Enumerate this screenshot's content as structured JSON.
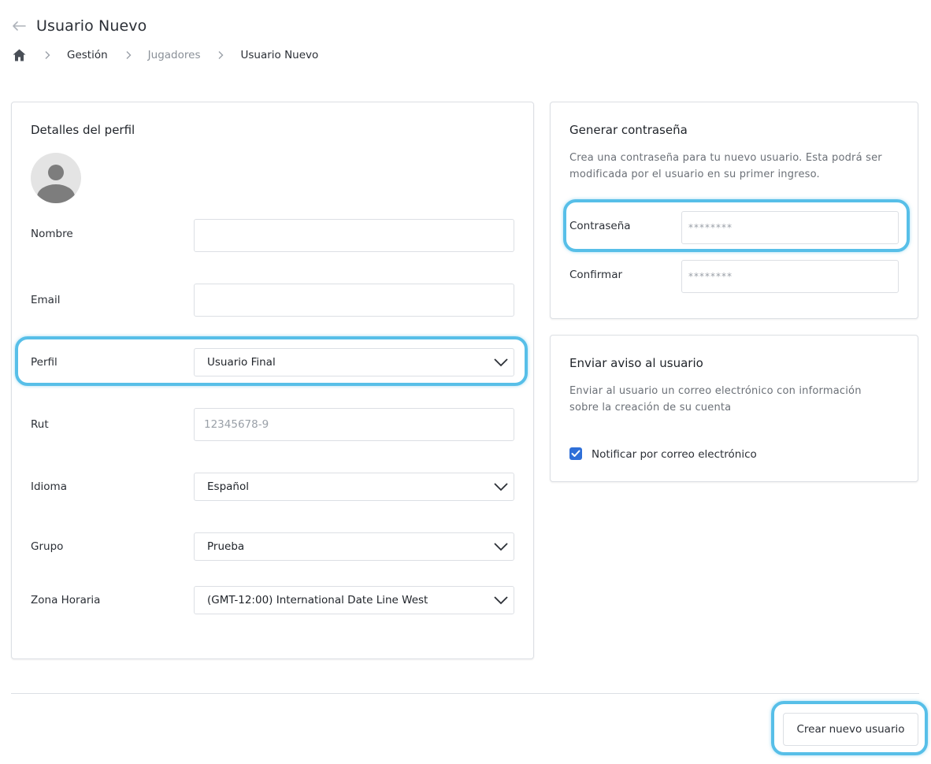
{
  "header": {
    "title": "Usuario Nuevo"
  },
  "breadcrumb": {
    "items": [
      "Gestión",
      "Jugadores",
      "Usuario Nuevo"
    ]
  },
  "profile": {
    "title": "Detalles del perfil",
    "fields": {
      "nombre": {
        "label": "Nombre",
        "value": ""
      },
      "email": {
        "label": "Email",
        "value": ""
      },
      "perfil": {
        "label": "Perfil",
        "value": "Usuario Final"
      },
      "rut": {
        "label": "Rut",
        "placeholder": "12345678-9"
      },
      "idioma": {
        "label": "Idioma",
        "value": "Español"
      },
      "grupo": {
        "label": "Grupo",
        "value": "Prueba"
      },
      "zona": {
        "label": "Zona Horaria",
        "value": "(GMT-12:00) International Date Line West"
      }
    }
  },
  "password": {
    "title": "Generar contraseña",
    "desc_line1": "Crea una contraseña para tu nuevo usuario. Esta podrá ser",
    "desc_line2": "modificada por el usuario en su primer ingreso.",
    "password_label": "Contraseña",
    "password_placeholder": "********",
    "confirm_label": "Confirmar",
    "confirm_placeholder": "********"
  },
  "notify": {
    "title": "Enviar aviso al usuario",
    "desc_line1": "Enviar al usuario un correo electrónico con información",
    "desc_line2": "sobre la creación de su cuenta",
    "checkbox_label": "Notificar por correo electrónico",
    "checked": true
  },
  "footer": {
    "submit_label": "Crear nuevo usuario"
  },
  "colors": {
    "highlight": "#57bfe8",
    "checkbox": "#2f6fd8",
    "border": "#dcdfe4"
  },
  "icons": [
    "back-arrow-icon",
    "home-icon",
    "chevron-right-icon",
    "chevron-down-icon",
    "user-avatar-icon",
    "checkmark-icon"
  ]
}
